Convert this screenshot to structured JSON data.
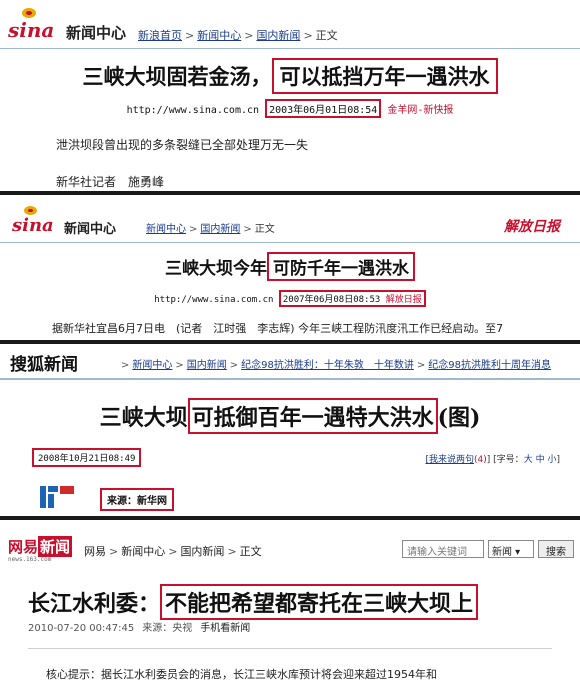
{
  "panel1": {
    "logo": "sina",
    "news_center": "新闻中心",
    "breadcrumbs": [
      "新浪首页",
      "新闻中心",
      "国内新闻",
      "正文"
    ],
    "separator": ">",
    "title_plain": "三峡大坝固若金汤，",
    "title_highlight": "可以抵挡万年一遇洪水",
    "url": "http://www.sina.com.cn",
    "datetime": "2003年06月01日08:54",
    "source": "金羊网-新快报",
    "lead": "泄洪坝段曾出现的多条裂缝已全部处理万无一失",
    "byline": "新华社记者　施勇峰"
  },
  "panel2": {
    "logo": "sina",
    "news_center": "新闻中心",
    "breadcrumbs": [
      "新闻中心",
      "国内新闻",
      "正文"
    ],
    "separator": ">",
    "paper_logo": "解放日报",
    "title_plain": "三峡大坝今年",
    "title_highlight": "可防千年一遇洪水",
    "url": "http://www.sina.com.cn",
    "datetime": "2007年06月08日08:53",
    "source": "解放日报",
    "lead": "据新华社宜昌6月7日电　(记者　江时强　李志辉) 今年三峡工程防汛度汛工作已经启动。至7"
  },
  "panel3": {
    "logo": "搜狐新闻",
    "breadcrumbs": [
      "新闻中心",
      "国内新闻",
      "纪念98抗洪胜利：十年朱敦　十年数讲",
      "纪念98抗洪胜利十周年消息"
    ],
    "separator": ">",
    "title_plain": "三峡大坝",
    "title_highlight": "可抵御百年一遇特大洪水",
    "title_suffix": "(图)",
    "datetime": "2008年10月21日08:49",
    "tools": {
      "comment_link": "[我来说两句",
      "comment_count": "(4)",
      "comment_close": "]",
      "font_label": "[字号：",
      "font_large": "大",
      "font_medium": "中",
      "font_small": "小",
      "font_close": "]"
    },
    "source": "来源：新华网"
  },
  "panel4": {
    "logo_a": "网易",
    "logo_b": "新闻",
    "logo_sub": "news.163.com",
    "breadcrumbs": [
      "网易",
      "新闻中心",
      "国内新闻",
      "正文"
    ],
    "separator": ">",
    "search_placeholder": "请输入关键词",
    "select_value": "新闻 ▾",
    "search_button": "搜索",
    "title_plain": "长江水利委：",
    "title_highlight": "不能把希望都寄托在三峡大坝上",
    "datetime": "2010-07-20  00:47:45",
    "source": "来源：央视",
    "mobile_link": "手机看新闻",
    "summary": "核心提示：据长江水利委员会的消息，长江三峡水库预计将会迎来超过1954年和"
  },
  "colors": {
    "highlight": "#c8102e",
    "link": "#1a3c8f",
    "sina_red": "#c8102e",
    "sina_yellow": "#e8a900",
    "netease_red": "#c8102e"
  }
}
